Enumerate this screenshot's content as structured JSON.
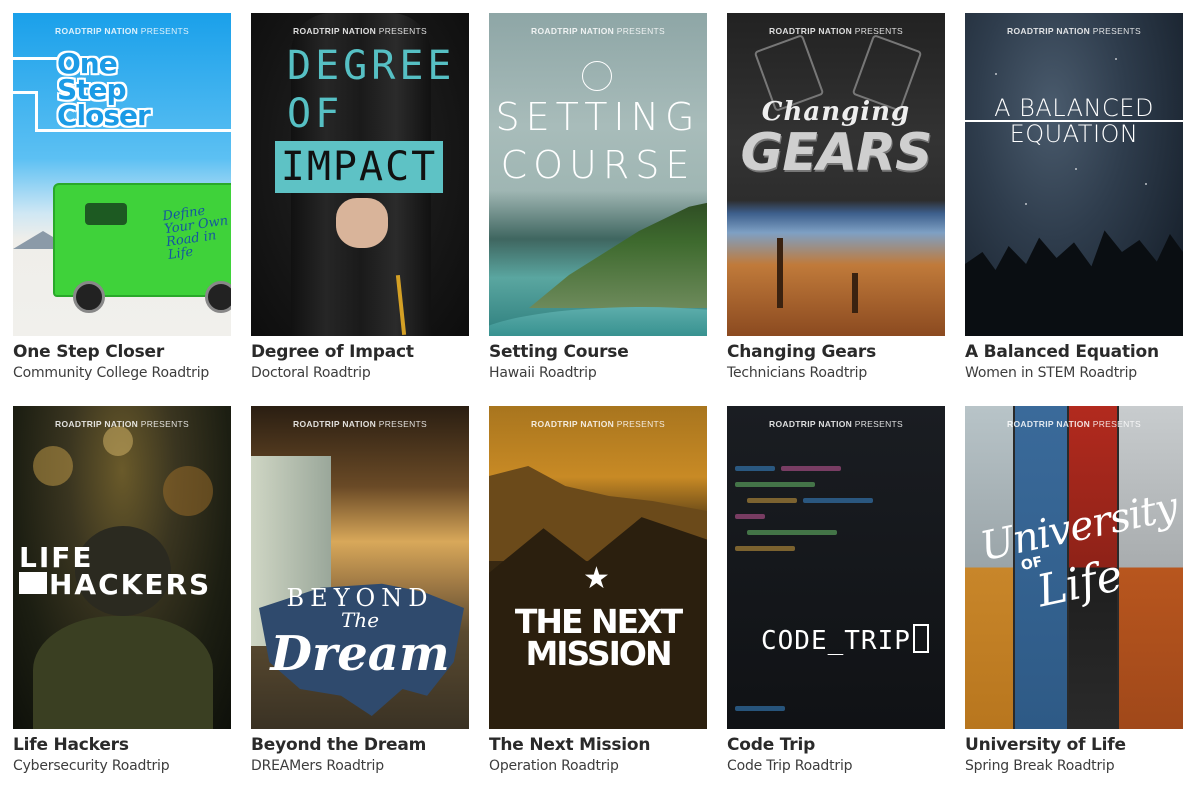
{
  "presents_brand": "ROADTRIP NATION",
  "presents_word": "PRESENTS",
  "cards": [
    {
      "title": "One Step Closer",
      "subtitle": "Community College Roadtrip",
      "poster_text": [
        "One",
        "Step",
        "Closer"
      ],
      "poster_tagline": [
        "Define",
        "Your Own",
        "Road in Life"
      ]
    },
    {
      "title": "Degree of Impact",
      "subtitle": "Doctoral Roadtrip",
      "poster_text": [
        "DEGREE",
        "OF",
        "IMPACT"
      ]
    },
    {
      "title": "Setting Course",
      "subtitle": "Hawaii Roadtrip",
      "poster_text": [
        "SETTING",
        "COURSE"
      ]
    },
    {
      "title": "Changing Gears",
      "subtitle": "Technicians Roadtrip",
      "poster_text": [
        "Changing",
        "GEARS"
      ]
    },
    {
      "title": "A Balanced Equation",
      "subtitle": "Women in STEM Roadtrip",
      "poster_text": [
        "A BALANCED",
        "EQUATION"
      ]
    },
    {
      "title": "Life Hackers",
      "subtitle": "Cybersecurity Roadtrip",
      "poster_text": [
        "LIFE",
        "HACKERS"
      ]
    },
    {
      "title": "Beyond the Dream",
      "subtitle": "DREAMers Roadtrip",
      "poster_text": [
        "BEYOND",
        "The",
        "Dream"
      ]
    },
    {
      "title": "The Next Mission",
      "subtitle": "Operation Roadtrip",
      "poster_text": [
        "THE NEXT",
        "MISSION"
      ]
    },
    {
      "title": "Code Trip",
      "subtitle": "Code Trip Roadtrip",
      "poster_text": [
        "CODE_TRIP"
      ]
    },
    {
      "title": "University of Life",
      "subtitle": "Spring Break Roadtrip",
      "poster_text": [
        "University",
        "OF",
        "Life"
      ]
    }
  ]
}
